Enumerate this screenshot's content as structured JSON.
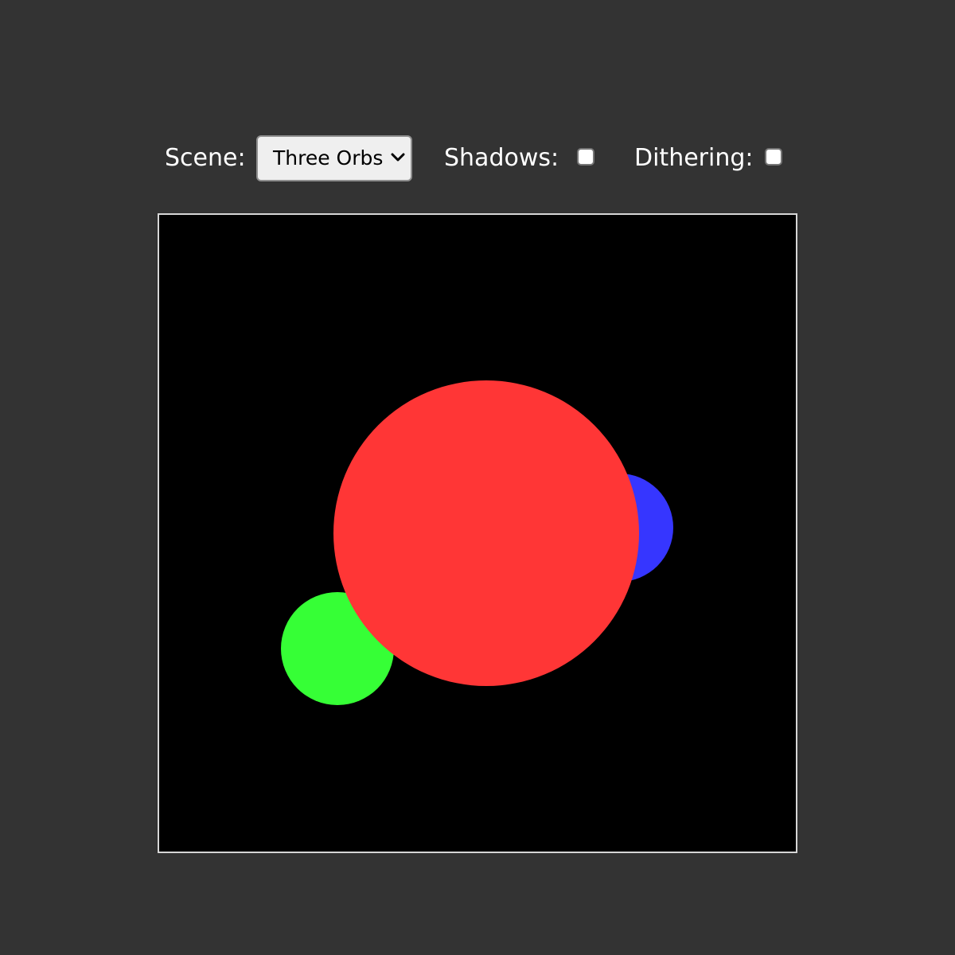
{
  "controls": {
    "scene_label": "Scene:",
    "scene_selected": "Three Orbs",
    "shadows_label": "Shadows:",
    "shadows_checked": false,
    "dithering_label": "Dithering:",
    "dithering_checked": false
  },
  "scene": {
    "background_color": "#000000",
    "orbs": [
      {
        "name": "blue-orb",
        "color": "#3636ff"
      },
      {
        "name": "green-orb",
        "color": "#36ff36"
      },
      {
        "name": "red-orb",
        "color": "#ff3636"
      }
    ]
  },
  "colors": {
    "page_background": "#333333",
    "text": "#ffffff",
    "canvas_border": "#d6d6d6"
  },
  "icons": {
    "select_arrow": "chevron-down-icon"
  }
}
